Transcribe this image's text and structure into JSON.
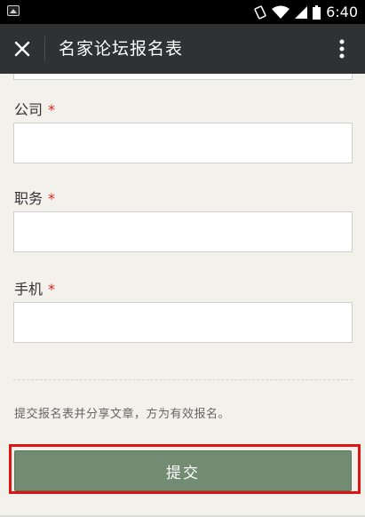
{
  "status_bar": {
    "time": "6:40"
  },
  "app_bar": {
    "title": "名家论坛报名表",
    "close_icon": "close-icon",
    "more_icon": "more-vert-icon"
  },
  "form": {
    "fields": [
      {
        "label": "公司",
        "required_mark": "*",
        "value": ""
      },
      {
        "label": "职务",
        "required_mark": "*",
        "value": ""
      },
      {
        "label": "手机",
        "required_mark": "*",
        "value": ""
      }
    ],
    "note": "提交报名表并分享文章，方为有效报名。",
    "submit_label": "提交"
  },
  "colors": {
    "status_bar_bg": "#000000",
    "app_bar_bg": "#2f3132",
    "page_bg": "#f2f1ec",
    "required": "#e0241d",
    "submit_bg": "#728b73",
    "highlight": "#e0140f"
  }
}
